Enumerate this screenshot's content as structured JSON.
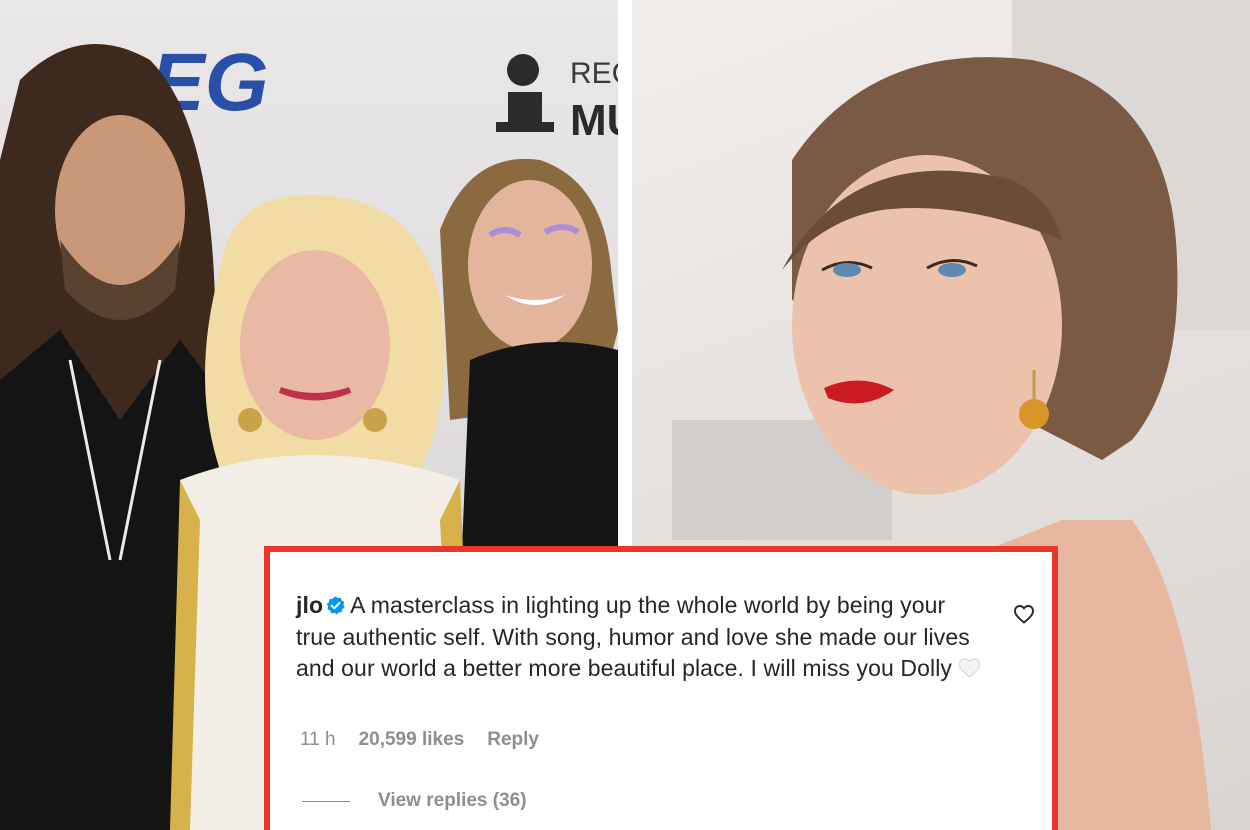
{
  "comment": {
    "username": "jlo",
    "verified": true,
    "text": "A masterclass in lighting up the whole world by being your true authentic self. With song, humor and love she made our lives and our world a better more beautiful place. I will miss you Dolly",
    "emoji": "white-heart",
    "time": "11 h",
    "likes": "20,599 likes",
    "reply_label": "Reply",
    "view_replies": "View replies (36)"
  },
  "backdrop": {
    "left_logo_fragment": "EG",
    "left_sign_fragment_1": "REC",
    "left_sign_fragment_2": "MU"
  },
  "colors": {
    "highlight_border": "#e8372a",
    "verified_blue": "#0095f6",
    "muted_text": "#8e8e8e",
    "body_text": "#262626"
  }
}
